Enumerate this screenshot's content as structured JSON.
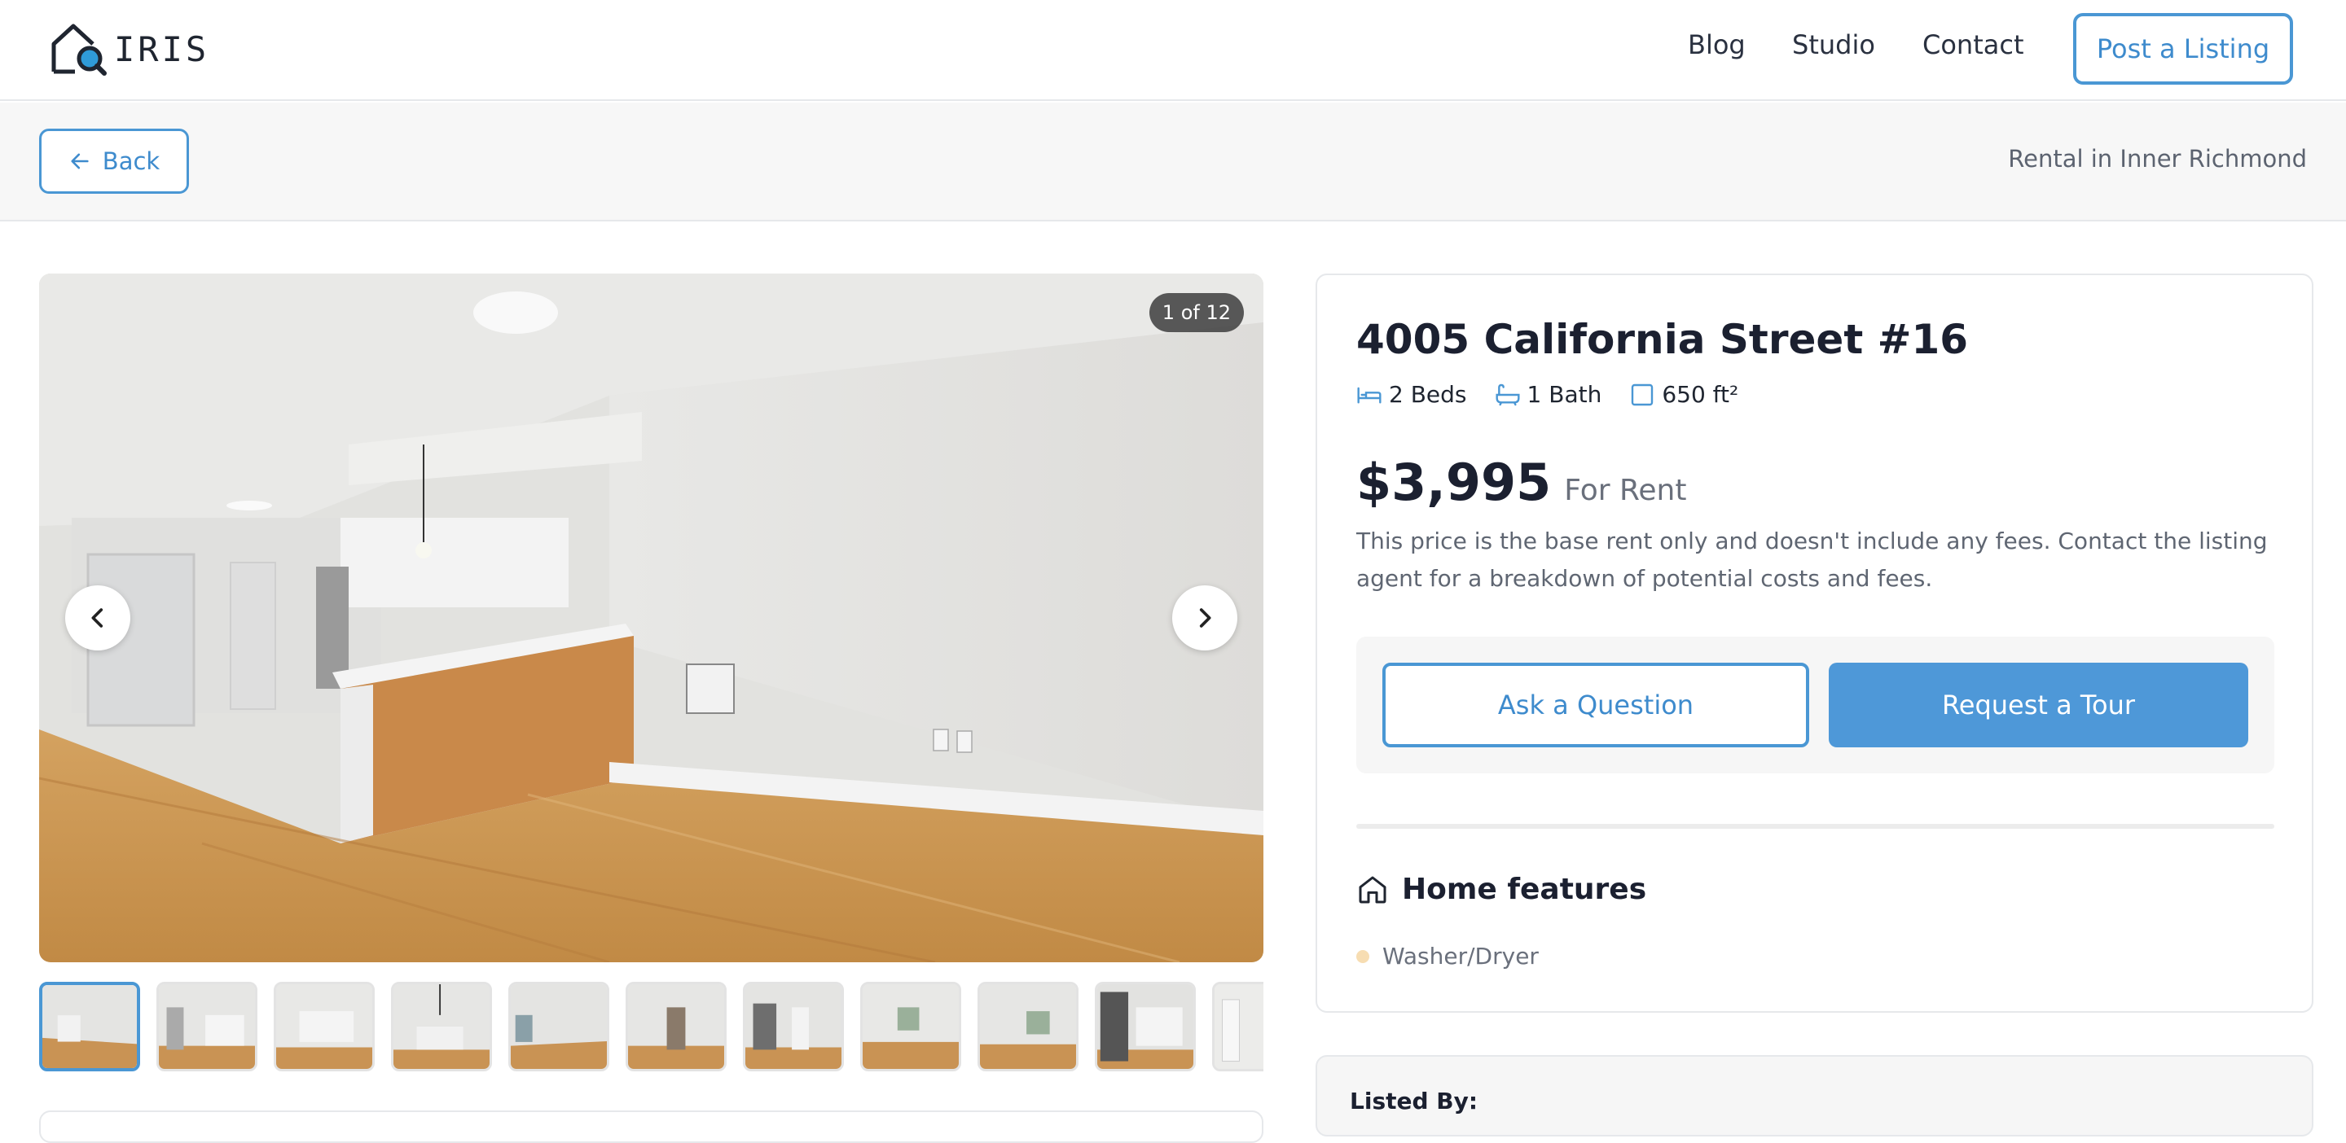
{
  "header": {
    "brand": "IRIS",
    "nav": {
      "blog": "Blog",
      "studio": "Studio",
      "contact": "Contact"
    },
    "post_listing": "Post a Listing"
  },
  "subbar": {
    "back_label": "Back",
    "breadcrumb": "Rental in Inner Richmond"
  },
  "gallery": {
    "counter": "1 of 12",
    "current_index": 1,
    "total": 12,
    "visible_thumbnails": 11
  },
  "listing": {
    "address": "4005 California Street #16",
    "beds": "2 Beds",
    "baths": "1 Bath",
    "area": "650 ft²",
    "price": "$3,995",
    "price_type": "For Rent",
    "price_note": "This price is the base rent only and doesn't include any fees. Contact the listing agent for a breakdown of potential costs and fees.",
    "ask_question": "Ask a Question",
    "request_tour": "Request a Tour",
    "features_title": "Home features",
    "features": [
      "Washer/Dryer"
    ],
    "listed_by": "Listed By:"
  },
  "icons": {
    "logo": "house-search-icon",
    "back": "arrow-left-icon",
    "prev": "chevron-left-icon",
    "next": "chevron-right-icon",
    "beds": "bed-icon",
    "baths": "bath-icon",
    "area": "square-icon",
    "features": "home-icon"
  },
  "colors": {
    "accent": "#4a97d4",
    "primary_button": "#4e98d8",
    "feature_dot": "#f7ddb2"
  }
}
